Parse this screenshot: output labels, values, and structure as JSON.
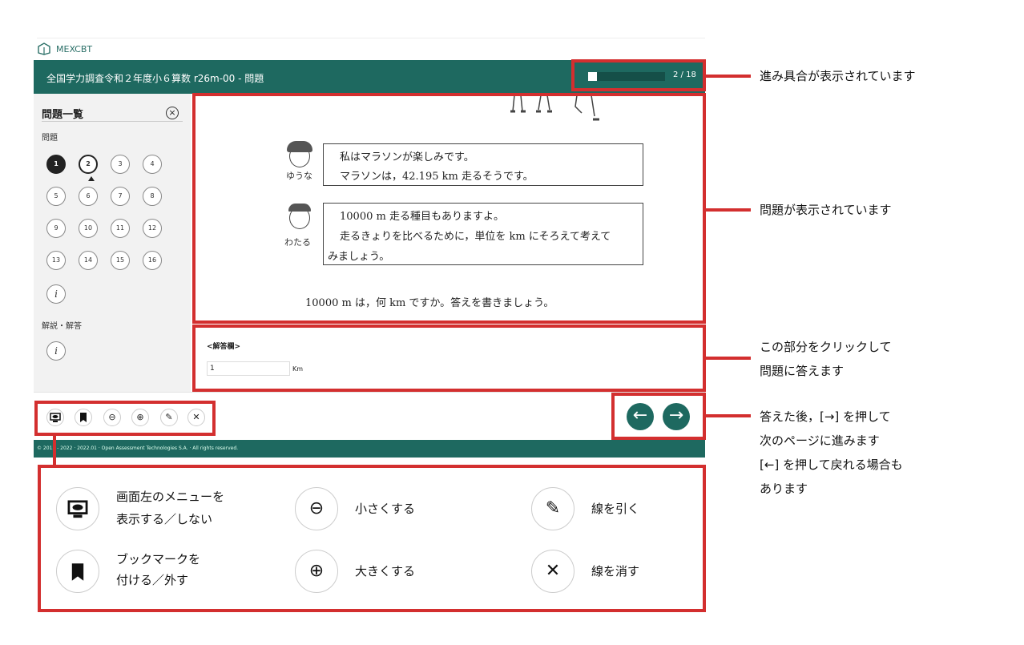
{
  "logo": {
    "text": "MEXCBT"
  },
  "header": {
    "title": "全国学力調査令和２年度小６算数 r26m-00 - 問題",
    "progress_text": "2 / 18",
    "progress_fraction": 0.11
  },
  "sidebar": {
    "title": "問題一覧",
    "questions_label": "問題",
    "questions": [
      "1",
      "2",
      "3",
      "4",
      "5",
      "6",
      "7",
      "8",
      "9",
      "10",
      "11",
      "12",
      "13",
      "14",
      "15",
      "16"
    ],
    "active_question": "1",
    "current_question": "2",
    "info_icon": "i",
    "explanation_label": "解説・解答"
  },
  "question": {
    "char1": {
      "name": "ゆうな",
      "line1": "私はマラソンが楽しみです。",
      "line2": "マラソンは，42.195 km 走るそうです。"
    },
    "char2": {
      "name": "わたる",
      "line1": "10000 m 走る種目もありますよ。",
      "line2": "走るきょりを比べるために，単位を km にそろえて考えて",
      "line3": "みましょう。"
    },
    "prompt": "10000 m は，何 km ですか。答えを書きましょう。"
  },
  "answer": {
    "label": "<解答欄>",
    "value": "1",
    "unit": "Km"
  },
  "footer": {
    "copyright": "© 2013 - 2022 · 2022.01 · Open Assessment Technologies S.A. · All rights reserved."
  },
  "annotations": {
    "progress": "進み具合が表示されています",
    "question": "問題が表示されています",
    "answer_line1": "この部分をクリックして",
    "answer_line2": "問題に答えます",
    "nav_line1": "答えた後，[→] を押して",
    "nav_line2": "次のページに進みます",
    "nav_line3": "[←] を押して戻れる場合も",
    "nav_line4": "あります"
  },
  "legend": {
    "eye_line1": "画面左のメニューを",
    "eye_line2": "表示する／しない",
    "bookmark_line1": "ブックマークを",
    "bookmark_line2": "付ける／外す",
    "zoom_out": "小さくする",
    "zoom_in": "大きくする",
    "draw_line": "線を引く",
    "erase_line": "線を消す"
  },
  "colors": {
    "brand": "#1e6960",
    "annotation_red": "#d32f2f"
  },
  "icons": {
    "tool_eye": "eye-monitor-icon",
    "tool_bookmark": "bookmark-icon",
    "tool_zoom_out": "zoom-out-icon",
    "tool_zoom_in": "zoom-in-icon",
    "tool_pen": "pen-icon",
    "tool_erase": "x-icon",
    "nav_prev": "arrow-left-icon",
    "nav_next": "arrow-right-icon"
  }
}
